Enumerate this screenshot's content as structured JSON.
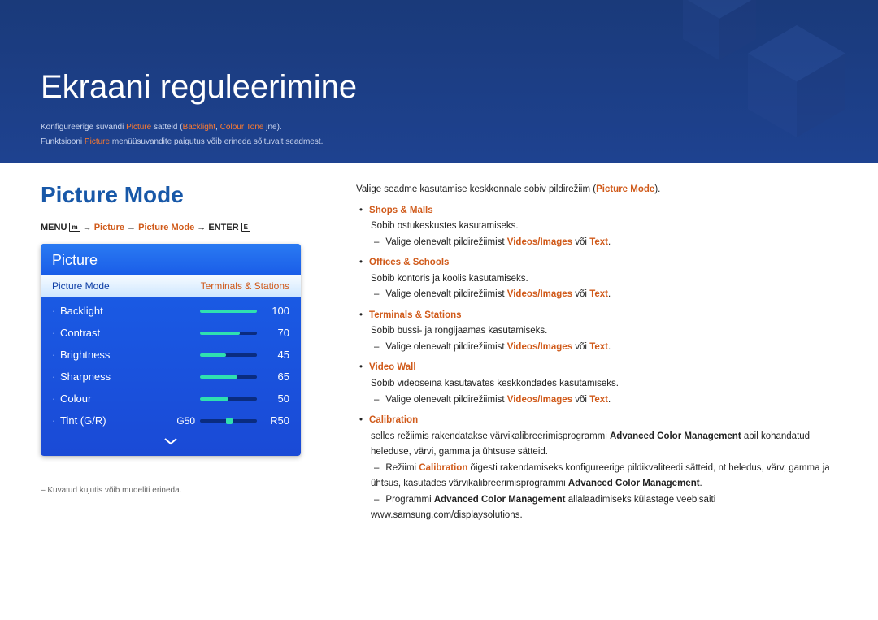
{
  "page": {
    "title": "Ekraani reguleerimine",
    "intro_1a": "Konfigureerige suvandi ",
    "intro_1b": "Picture",
    "intro_1c": " sätteid (",
    "intro_1d": "Backlight",
    "intro_1e": ", ",
    "intro_1f": "Colour Tone",
    "intro_1g": " jne).",
    "intro_2a": "Funktsiooni ",
    "intro_2b": "Picture",
    "intro_2c": " menüüsuvandite paigutus võib erineda sõltuvalt seadmest."
  },
  "section": {
    "title": "Picture Mode"
  },
  "breadcrumb": {
    "menu": "MENU",
    "menu_icon": "m",
    "arrow": " → ",
    "p1": "Picture",
    "p2": "Picture Mode",
    "enter": "ENTER",
    "enter_icon": "E"
  },
  "osd": {
    "head": "Picture",
    "sel_label": "Picture Mode",
    "sel_value": "Terminals & Stations",
    "rows": [
      {
        "label": "Backlight",
        "value": "100",
        "pct": 100
      },
      {
        "label": "Contrast",
        "value": "70",
        "pct": 70
      },
      {
        "label": "Brightness",
        "value": "45",
        "pct": 45
      },
      {
        "label": "Sharpness",
        "value": "65",
        "pct": 65
      },
      {
        "label": "Colour",
        "value": "50",
        "pct": 50
      }
    ],
    "tint": {
      "label": "Tint (G/R)",
      "left": "G50",
      "right": "R50",
      "pct": 50
    }
  },
  "footnote": {
    "text": "Kuvatud kujutis võib mudeliti erineda."
  },
  "right": {
    "lead_a": "Valige seadme kasutamise keskkonnale sobiv pildirežiim (",
    "lead_b": "Picture Mode",
    "lead_c": ").",
    "modes": [
      {
        "name": "Shops & Malls",
        "desc": "Sobib ostukeskustes kasutamiseks.",
        "sub": [
          {
            "a": "Valige olenevalt pildirežiimist ",
            "b": "Videos/Images",
            "c": " või ",
            "d": "Text",
            "e": "."
          }
        ]
      },
      {
        "name": "Offices & Schools",
        "desc": "Sobib kontoris ja koolis kasutamiseks.",
        "sub": [
          {
            "a": "Valige olenevalt pildirežiimist ",
            "b": "Videos/Images",
            "c": " või ",
            "d": "Text",
            "e": "."
          }
        ]
      },
      {
        "name": "Terminals & Stations",
        "desc": "Sobib bussi- ja rongijaamas kasutamiseks.",
        "sub": [
          {
            "a": "Valige olenevalt pildirežiimist ",
            "b": "Videos/Images",
            "c": " või ",
            "d": "Text",
            "e": "."
          }
        ]
      },
      {
        "name": "Video Wall",
        "desc": "Sobib videoseina kasutavates keskkondades kasutamiseks.",
        "sub": [
          {
            "a": "Valige olenevalt pildirežiimist ",
            "b": "Videos/Images",
            "c": " või ",
            "d": "Text",
            "e": "."
          }
        ]
      }
    ],
    "calibration": {
      "name": "Calibration",
      "desc_a": "selles režiimis rakendatakse värvikalibreerimisprogrammi ",
      "desc_b": "Advanced Color Management",
      "desc_c": " abil kohandatud heleduse, värvi, gamma ja ühtsuse sätteid.",
      "sub1_a": "Režiimi ",
      "sub1_b": "Calibration",
      "sub1_c": " õigesti rakendamiseks konfigureerige pildikvaliteedi sätteid, nt heledus, värv, gamma ja ühtsus, kasutades värvikalibreerimisprogrammi ",
      "sub1_d": "Advanced Color Management",
      "sub1_e": ".",
      "sub2_a": "Programmi ",
      "sub2_b": "Advanced Color Management",
      "sub2_c": " allalaadimiseks külastage veebisaiti www.samsung.com/displaysolutions."
    }
  }
}
